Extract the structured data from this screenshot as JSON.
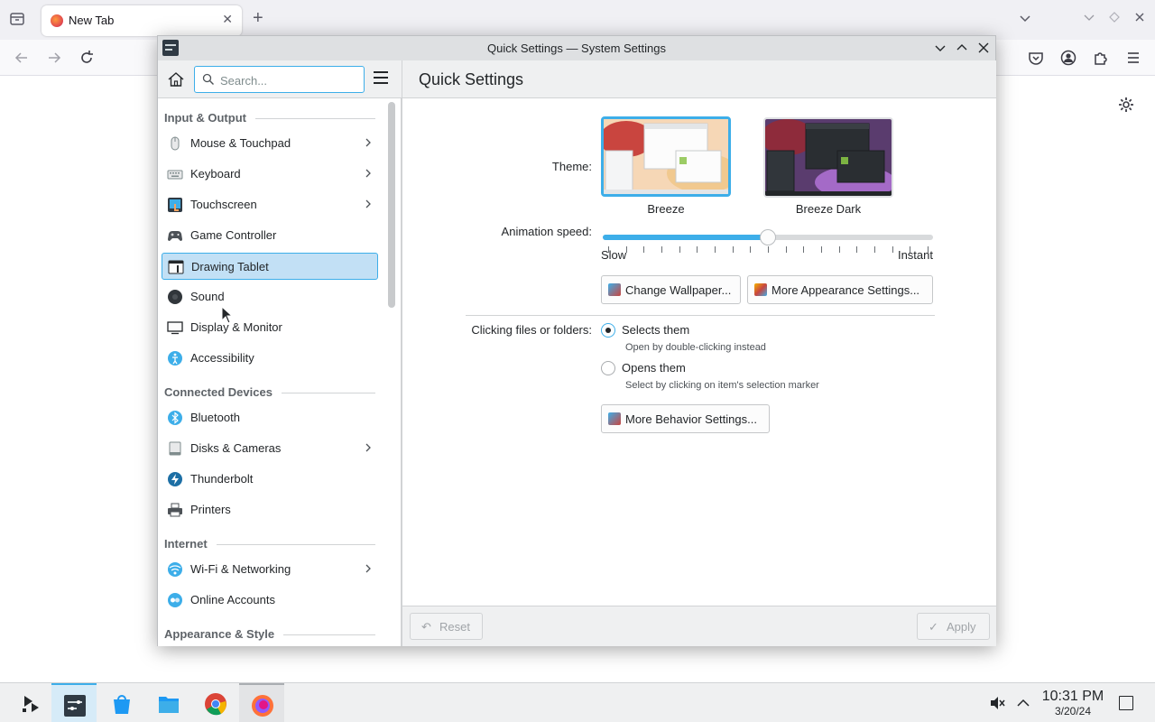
{
  "browser": {
    "tab_title": "New Tab",
    "tab_close": "✕",
    "new_tab": "+",
    "colors": {
      "tabbar": "#f0f0f4",
      "navbar": "#f9f9fb"
    }
  },
  "window": {
    "title": "Quick Settings — System Settings",
    "buttons": [
      "chevron-down-icon",
      "chevron-up-icon",
      "close-icon"
    ]
  },
  "search": {
    "placeholder": "Search...",
    "value": ""
  },
  "page_title": "Quick Settings",
  "sidebar": {
    "sections": [
      {
        "label": "Input & Output",
        "items": [
          {
            "label": "Mouse & Touchpad",
            "icon": "mouse-icon",
            "has_children": true
          },
          {
            "label": "Keyboard",
            "icon": "keyboard-icon",
            "has_children": true
          },
          {
            "label": "Touchscreen",
            "icon": "touchscreen-icon",
            "has_children": true
          },
          {
            "label": "Game Controller",
            "icon": "gamepad-icon",
            "has_children": false
          },
          {
            "label": "Drawing Tablet",
            "icon": "tablet-icon",
            "has_children": false,
            "selected": true
          },
          {
            "label": "Sound",
            "icon": "sound-icon",
            "has_children": false
          },
          {
            "label": "Display & Monitor",
            "icon": "monitor-icon",
            "has_children": false
          },
          {
            "label": "Accessibility",
            "icon": "accessibility-icon",
            "has_children": false
          }
        ]
      },
      {
        "label": "Connected Devices",
        "items": [
          {
            "label": "Bluetooth",
            "icon": "bluetooth-icon",
            "has_children": false
          },
          {
            "label": "Disks & Cameras",
            "icon": "disk-icon",
            "has_children": true
          },
          {
            "label": "Thunderbolt",
            "icon": "thunderbolt-icon",
            "has_children": false
          },
          {
            "label": "Printers",
            "icon": "printer-icon",
            "has_children": false
          }
        ]
      },
      {
        "label": "Internet",
        "items": [
          {
            "label": "Wi-Fi & Networking",
            "icon": "network-icon",
            "has_children": true
          },
          {
            "label": "Online Accounts",
            "icon": "online-accounts-icon",
            "has_children": false
          }
        ]
      },
      {
        "label": "Appearance & Style",
        "items": []
      }
    ]
  },
  "quick_settings": {
    "theme_label": "Theme:",
    "themes": [
      {
        "name": "Breeze",
        "selected": true
      },
      {
        "name": "Breeze Dark",
        "selected": false
      }
    ],
    "animation_label": "Animation speed:",
    "animation_value_fraction": 0.5,
    "animation_min_label": "Slow",
    "animation_max_label": "Instant",
    "change_wallpaper": "Change Wallpaper...",
    "more_appearance": "More Appearance Settings...",
    "clicking_label": "Clicking files or folders:",
    "click_options": [
      {
        "label": "Selects them",
        "sub": "Open by double-clicking instead",
        "checked": true
      },
      {
        "label": "Opens them",
        "sub": "Select by clicking on item's selection marker",
        "checked": false
      }
    ],
    "more_behavior": "More Behavior Settings..."
  },
  "footer": {
    "reset": "Reset",
    "apply": "Apply"
  },
  "taskbar": {
    "apps": [
      "app-launcher-icon",
      "system-settings-icon",
      "discover-icon",
      "files-icon",
      "chrome-icon",
      "firefox-icon"
    ],
    "clock_time": "10:31 PM",
    "clock_date": "3/20/24"
  },
  "accent_color": "#3daee9"
}
